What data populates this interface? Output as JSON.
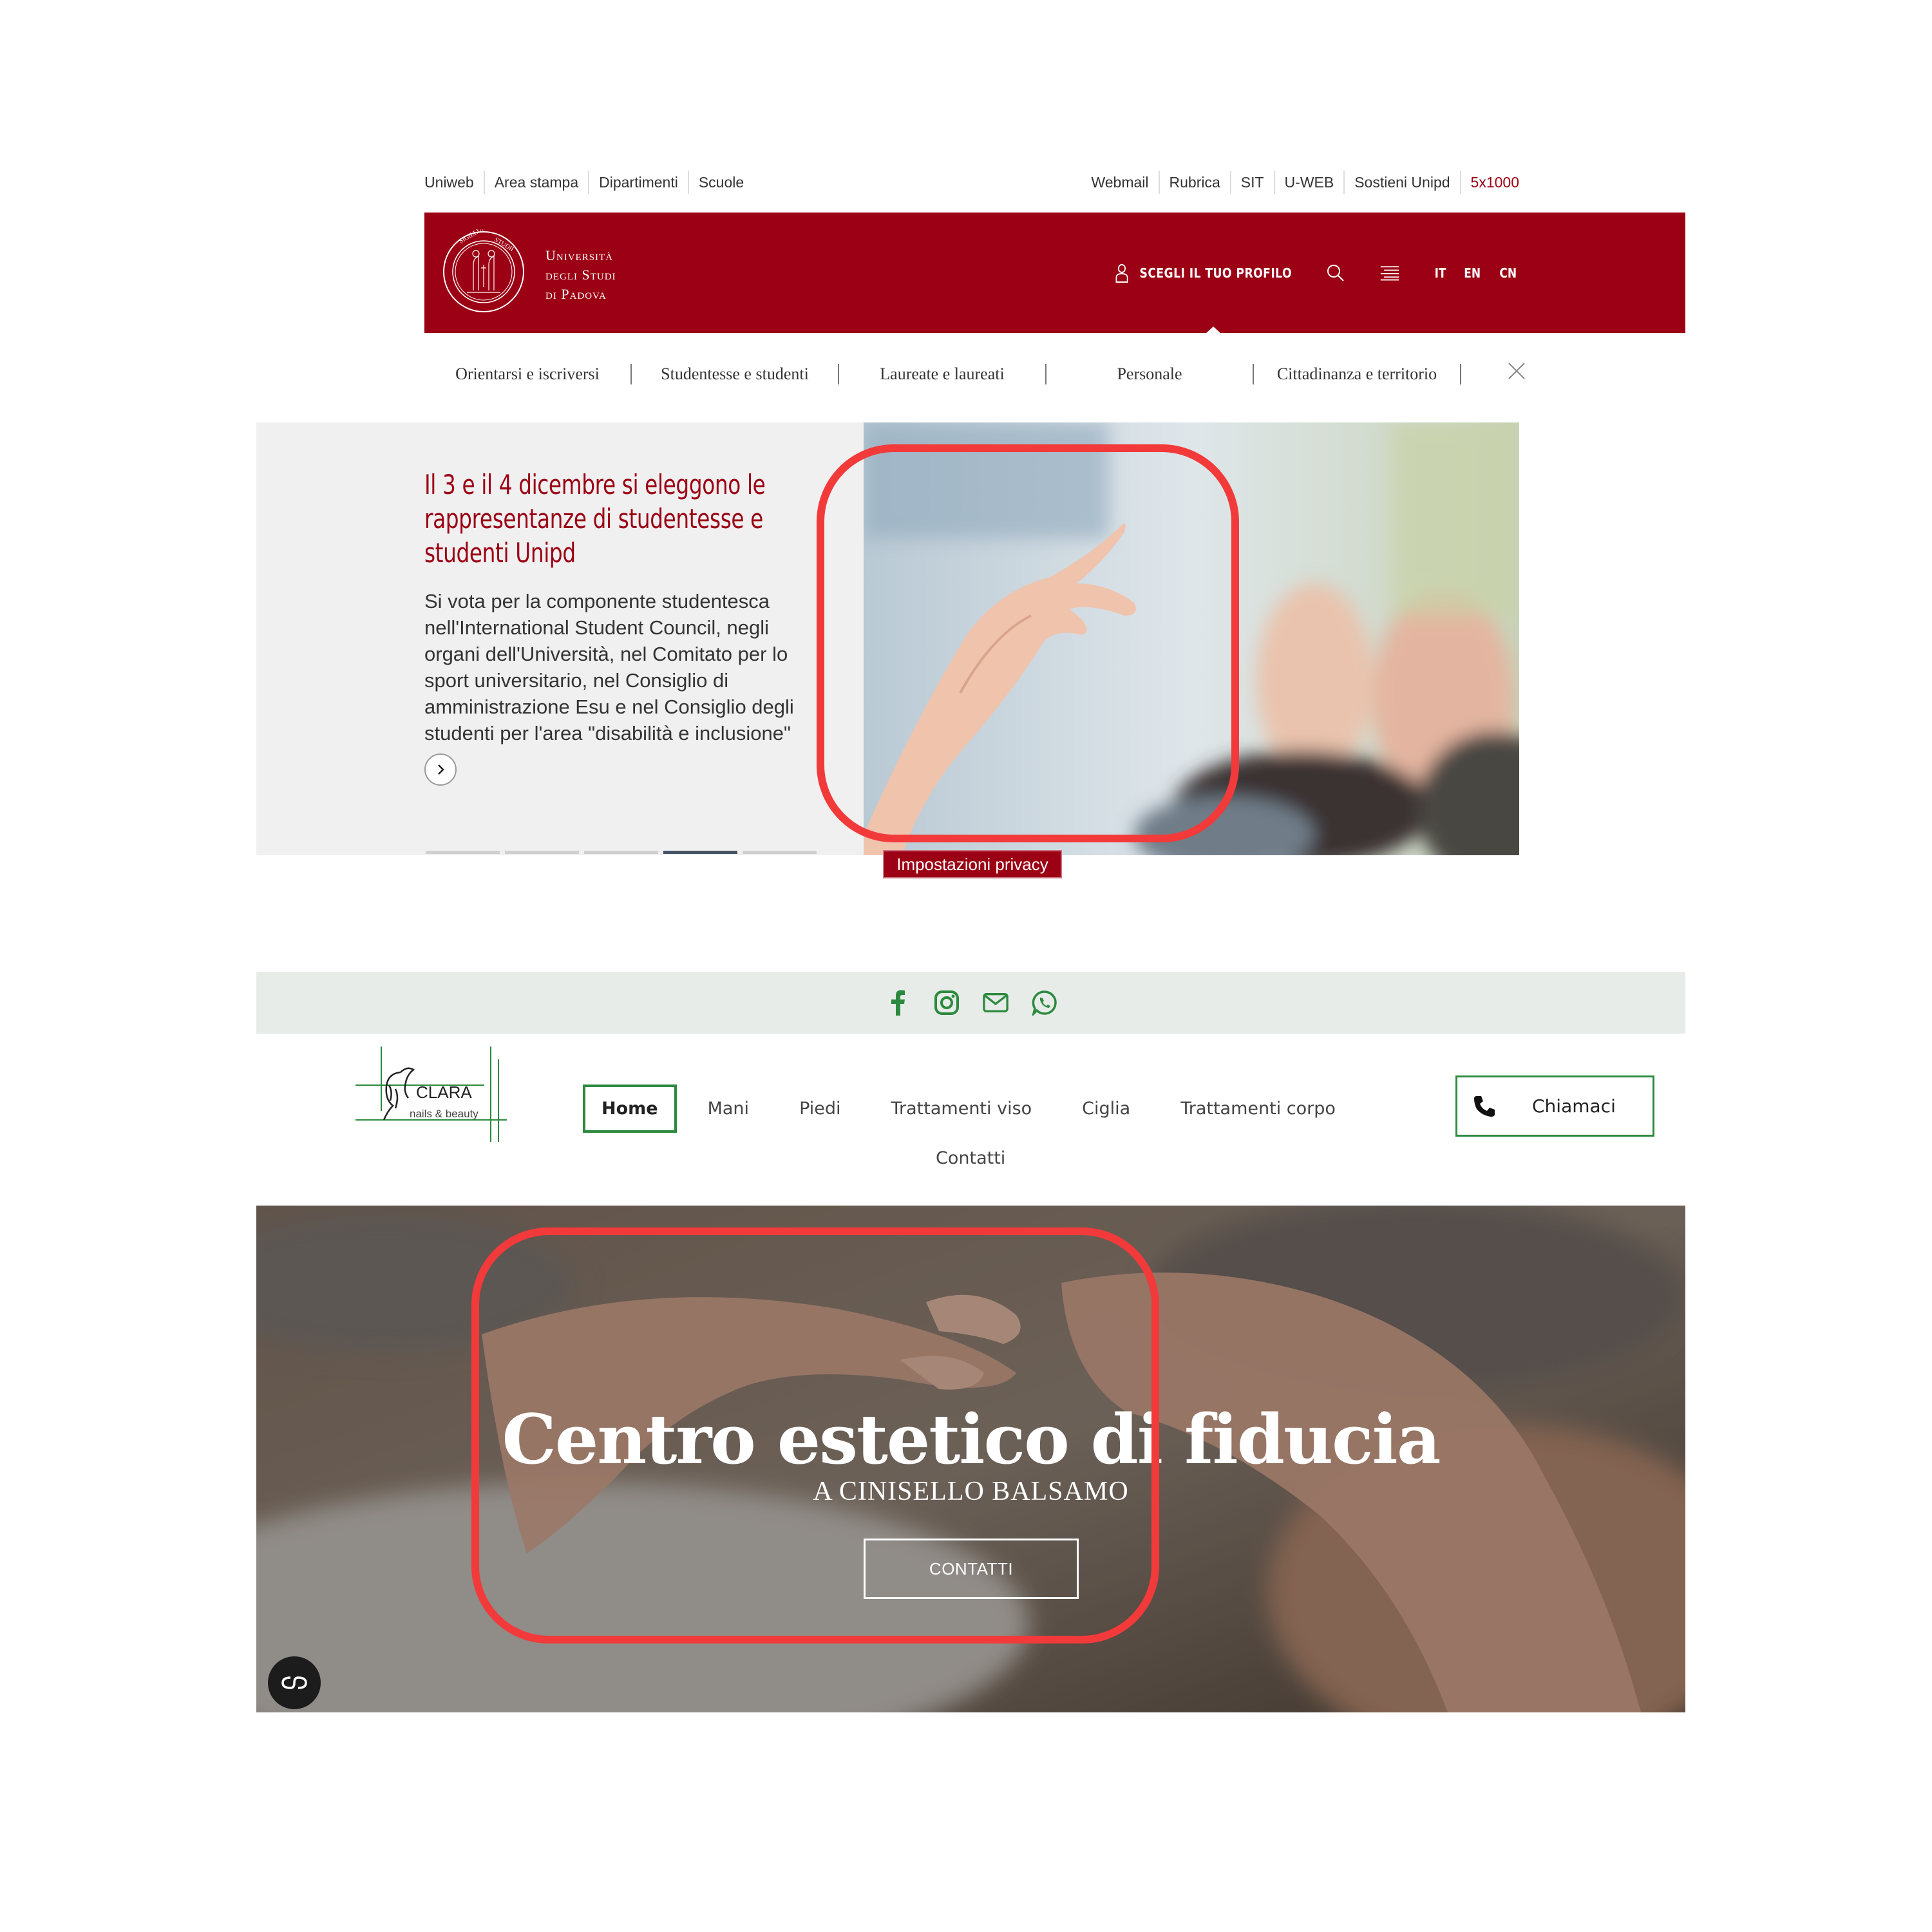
{
  "unipd": {
    "util_left": [
      "Uniweb",
      "Area stampa",
      "Dipartimenti",
      "Scuole"
    ],
    "util_right": [
      "Webmail",
      "Rubrica",
      "SIT",
      "U-WEB",
      "Sostieni Unipd",
      "5x1000"
    ],
    "name_lines": [
      "Università",
      "degli Studi",
      "di Padova"
    ],
    "profile_label": "SCEGLI IL TUO PROFILO",
    "languages": [
      "IT",
      "EN",
      "CN"
    ],
    "nav": [
      "Orientarsi e iscriversi",
      "Studentesse e studenti",
      "Laureate e laureati",
      "Personale",
      "Cittadinanza e territorio"
    ],
    "hero": {
      "title": "Il 3 e il 4 dicembre si eleggono le rappresentanze di studentesse e studenti Unipd",
      "description": "Si vota per la componente studentesca nell'International Student Council, negli organi dell'Università, nel Comitato per lo sport universitario, nel Consiglio di amministrazione Esu e nel Consiglio degli studenti per l'area \"disabilità e inclusione\"",
      "slides_total": 5,
      "active_slide": 4
    },
    "privacy_label": "Impostazioni privacy",
    "brand_color": "#9b0014"
  },
  "clara": {
    "social_icons": [
      "facebook-icon",
      "instagram-icon",
      "mail-icon",
      "whatsapp-icon"
    ],
    "logo_name": "CLARA",
    "logo_tagline": "nails & beauty",
    "nav": [
      "Home",
      "Mani",
      "Piedi",
      "Trattamenti viso",
      "Ciglia",
      "Trattamenti corpo"
    ],
    "nav_row2": "Contatti",
    "call_label": "Chiamaci",
    "hero": {
      "title": "Centro estetico di fiducia",
      "subtitle": "A CINISELLO BALSAMO",
      "button": "CONTATTI"
    },
    "accent_color": "#2b8a3e"
  }
}
